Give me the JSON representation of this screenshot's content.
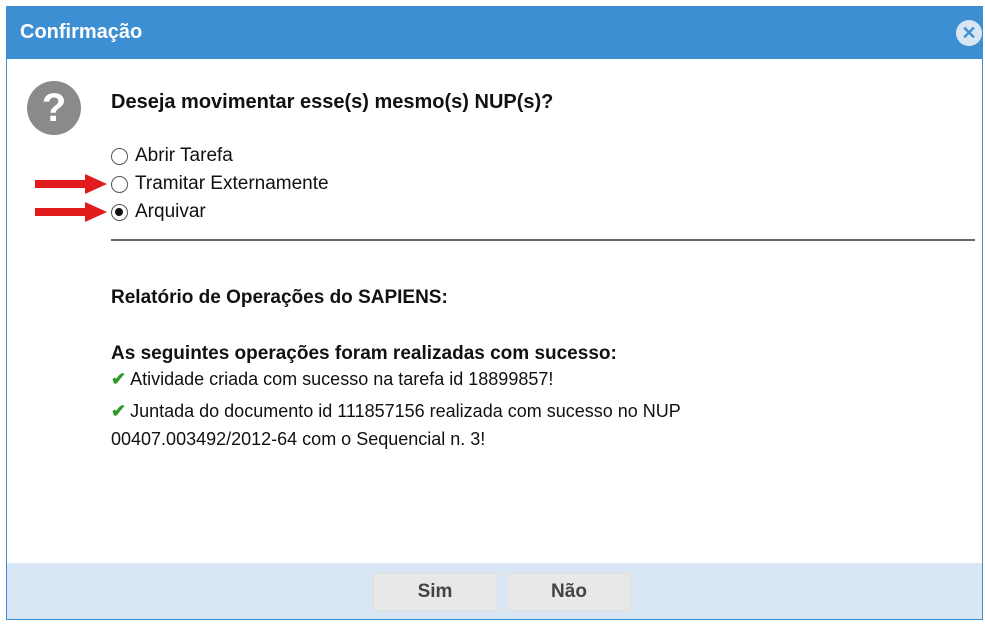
{
  "window": {
    "title": "Confirmação",
    "close_icon": "close-icon"
  },
  "dialog": {
    "question": "Deseja movimentar esse(s) mesmo(s) NUP(s)?",
    "question_icon": "?",
    "options": [
      {
        "label": "Abrir Tarefa",
        "checked": false
      },
      {
        "label": "Tramitar Externamente",
        "checked": false
      },
      {
        "label": "Arquivar",
        "checked": true
      }
    ],
    "annotation_arrow_color": "#e11b1b"
  },
  "report": {
    "title": "Relatório de Operações do SAPIENS:",
    "success_heading": "As seguintes operações foram realizadas com sucesso:",
    "lines": [
      "Atividade criada com sucesso na tarefa id 18899857!",
      "Juntada do documento id 111857156 realizada com sucesso no NUP",
      "00407.003492/2012-64 com o Sequencial n. 3!"
    ],
    "check_color": "#2a9a2a"
  },
  "buttons": {
    "yes": "Sim",
    "no": "Não"
  },
  "colors": {
    "titlebar": "#3d8fd4",
    "footer": "#d9e6f3"
  }
}
